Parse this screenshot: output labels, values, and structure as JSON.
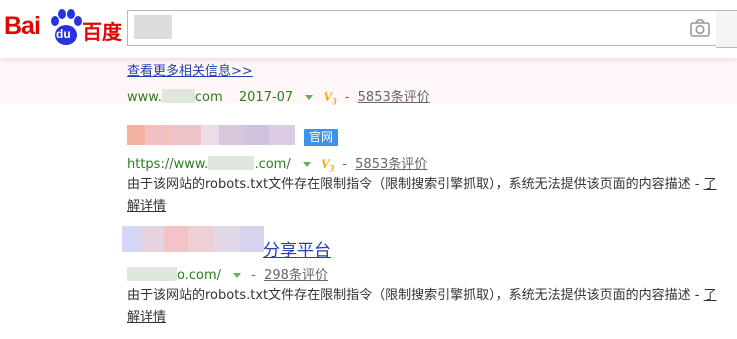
{
  "logo": {
    "latin": "Bai",
    "paw_text": "du",
    "cn": "百度"
  },
  "search": {
    "value": ""
  },
  "results": [
    {
      "more_link": "查看更多相关信息>>",
      "url_prefix": "www.",
      "url_suffix": "com",
      "date": "2017-07",
      "v_badge": "V",
      "v_level": "3",
      "dash": "-",
      "rating": "5853条评价"
    },
    {
      "badge": "官网",
      "url_prefix": "https://www.",
      "url_suffix": ".com/",
      "v_badge": "V",
      "v_level": "3",
      "dash": "-",
      "rating": "5853条评价",
      "abstract": "由于该网站的robots.txt文件存在限制指令（限制搜索引擎抓取），系统无法提供该页面的内容描述 - ",
      "detail_link": "了解详情"
    },
    {
      "title_visible": "分享平台",
      "url_suffix": "o.com/",
      "dash": "-",
      "rating": "298条评价",
      "abstract": "由于该网站的robots.txt文件存在限制指令（限制搜索引擎抓取），系统无法提供该页面的内容描述 - ",
      "detail_link": "了解详情"
    }
  ],
  "colors": {
    "brand_red": "#e10602",
    "link_blue": "#2440b3",
    "url_green": "#2b7e1e",
    "badge_blue": "#3c94ea",
    "v_gold": "#f2a500"
  }
}
